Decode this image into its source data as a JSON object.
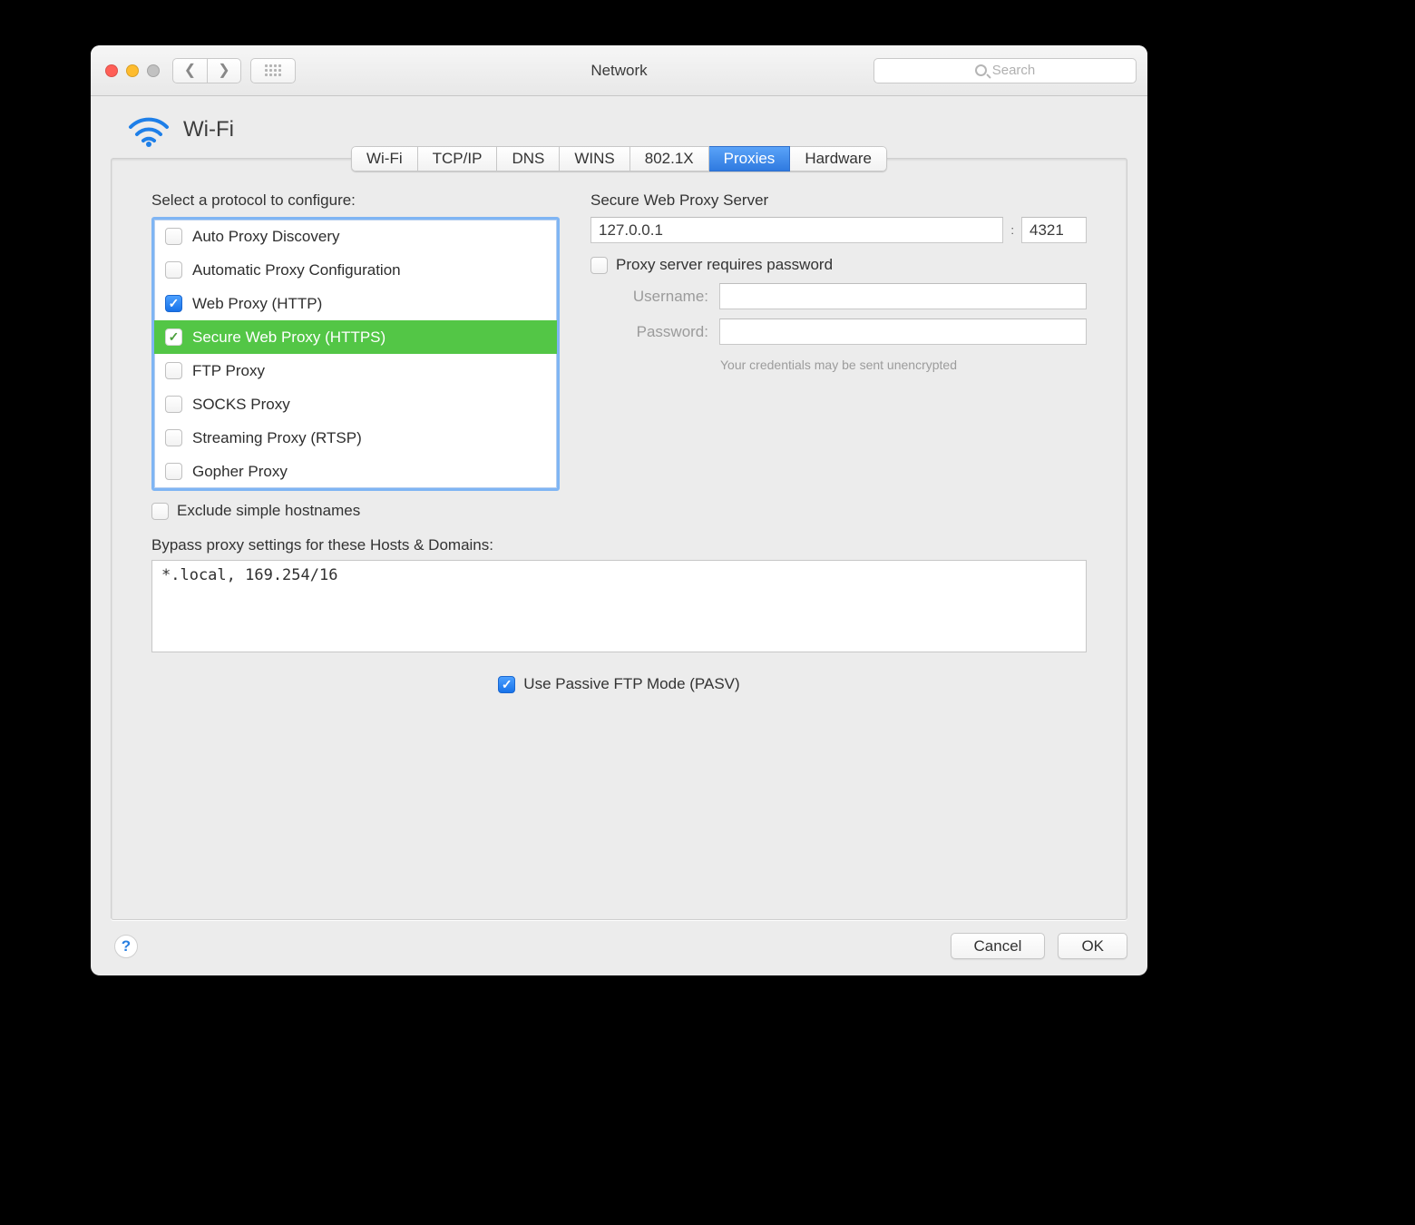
{
  "window": {
    "title": "Network",
    "search_placeholder": "Search"
  },
  "header": {
    "connection_name": "Wi-Fi"
  },
  "tabs": [
    "Wi-Fi",
    "TCP/IP",
    "DNS",
    "WINS",
    "802.1X",
    "Proxies",
    "Hardware"
  ],
  "active_tab": "Proxies",
  "protocols": {
    "label": "Select a protocol to configure:",
    "items": [
      {
        "label": "Auto Proxy Discovery",
        "checked": false,
        "selected": false
      },
      {
        "label": "Automatic Proxy Configuration",
        "checked": false,
        "selected": false
      },
      {
        "label": "Web Proxy (HTTP)",
        "checked": true,
        "selected": false
      },
      {
        "label": "Secure Web Proxy (HTTPS)",
        "checked": true,
        "selected": true
      },
      {
        "label": "FTP Proxy",
        "checked": false,
        "selected": false
      },
      {
        "label": "SOCKS Proxy",
        "checked": false,
        "selected": false
      },
      {
        "label": "Streaming Proxy (RTSP)",
        "checked": false,
        "selected": false
      },
      {
        "label": "Gopher Proxy",
        "checked": false,
        "selected": false
      }
    ]
  },
  "server": {
    "label": "Secure Web Proxy Server",
    "host": "127.0.0.1",
    "port": "4321",
    "separator": ":"
  },
  "auth": {
    "requires_password_label": "Proxy server requires password",
    "requires_password_checked": false,
    "username_label": "Username:",
    "username_value": "",
    "password_label": "Password:",
    "password_value": "",
    "warning": "Your credentials may be sent unencrypted"
  },
  "exclude_simple": {
    "label": "Exclude simple hostnames",
    "checked": false
  },
  "bypass": {
    "label": "Bypass proxy settings for these Hosts & Domains:",
    "value": "*.local, 169.254/16"
  },
  "pasv": {
    "label": "Use Passive FTP Mode (PASV)",
    "checked": true
  },
  "buttons": {
    "help": "?",
    "cancel": "Cancel",
    "ok": "OK"
  }
}
